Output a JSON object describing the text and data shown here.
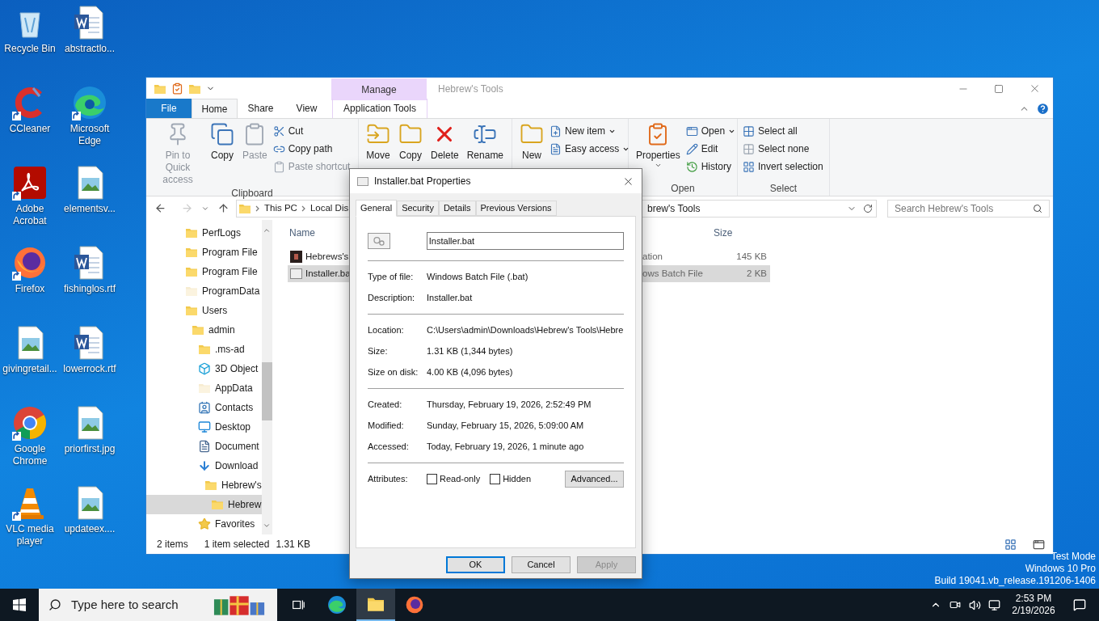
{
  "desktop_icons": [
    {
      "label": "Recycle Bin",
      "kind": "recycle-bin",
      "shortcut": false
    },
    {
      "label": "CCleaner",
      "kind": "ccleaner",
      "shortcut": true
    },
    {
      "label": "Adobe Acrobat",
      "kind": "acrobat",
      "shortcut": true
    },
    {
      "label": "Firefox",
      "kind": "firefox",
      "shortcut": true
    },
    {
      "label": "givingretail...",
      "kind": "image-file",
      "shortcut": false
    },
    {
      "label": "Google Chrome",
      "kind": "chrome",
      "shortcut": true
    },
    {
      "label": "VLC media player",
      "kind": "vlc",
      "shortcut": true
    },
    {
      "label": "abstractlo...",
      "kind": "word-file",
      "shortcut": false
    },
    {
      "label": "Microsoft Edge",
      "kind": "edge",
      "shortcut": true
    },
    {
      "label": "elementsv...",
      "kind": "image-file",
      "shortcut": false
    },
    {
      "label": "fishinglos.rtf",
      "kind": "word-file",
      "shortcut": false
    },
    {
      "label": "lowerrock.rtf",
      "kind": "word-file",
      "shortcut": false
    },
    {
      "label": "priorfirst.jpg",
      "kind": "image-file",
      "shortcut": false
    },
    {
      "label": "updateex....",
      "kind": "image-file",
      "shortcut": false
    }
  ],
  "explorer": {
    "title": "Hebrew's Tools",
    "contextual_group": "Manage",
    "tabs": [
      {
        "label": "File",
        "kind": "file",
        "selected": false
      },
      {
        "label": "Home",
        "kind": "tab",
        "selected": true
      },
      {
        "label": "Share",
        "kind": "tab",
        "selected": false
      },
      {
        "label": "View",
        "kind": "tab",
        "selected": false
      },
      {
        "label": "Application Tools",
        "kind": "contextual",
        "selected": false
      }
    ],
    "ribbon": [
      {
        "label": "Clipboard",
        "items": [
          {
            "label": "Pin to Quick access",
            "kind": "pin",
            "disabled": true,
            "dropdown": false
          },
          {
            "label": "Copy",
            "kind": "copy",
            "disabled": false,
            "dropdown": false
          },
          {
            "label": "Paste",
            "kind": "paste",
            "disabled": true,
            "dropdown": false
          },
          {
            "label": "Cut",
            "kind": "cut",
            "disabled": false,
            "dropdown": false
          },
          {
            "label": "Copy path",
            "kind": "copy-path",
            "disabled": false,
            "dropdown": false
          },
          {
            "label": "Paste shortcut",
            "kind": "paste-shortcut",
            "disabled": true,
            "dropdown": false
          }
        ]
      },
      {
        "items": [
          {
            "label": "Move",
            "kind": "move",
            "disabled": false,
            "dropdown": false
          },
          {
            "label": "Copy",
            "kind": "copy-to",
            "disabled": false,
            "dropdown": false
          },
          {
            "label": "Delete",
            "kind": "delete",
            "disabled": false,
            "dropdown": false
          },
          {
            "label": "Rename",
            "kind": "rename",
            "disabled": false,
            "dropdown": false
          }
        ]
      },
      {
        "items": [
          {
            "label": "New",
            "kind": "new-folder",
            "disabled": false,
            "dropdown": false
          },
          {
            "label": "New item",
            "kind": "new-item",
            "disabled": false,
            "dropdown": true
          },
          {
            "label": "Easy access",
            "kind": "easy-access",
            "disabled": false,
            "dropdown": true
          }
        ]
      },
      {
        "label": "Open",
        "items": [
          {
            "label": "Properties",
            "kind": "properties",
            "disabled": false,
            "dropdown": true
          },
          {
            "label": "Open",
            "kind": "open",
            "disabled": false,
            "dropdown": true
          },
          {
            "label": "Edit",
            "kind": "edit",
            "disabled": false,
            "dropdown": false
          },
          {
            "label": "History",
            "kind": "history",
            "disabled": false,
            "dropdown": false
          }
        ]
      },
      {
        "label": "Select",
        "items": [
          {
            "label": "Select all",
            "kind": "select-all",
            "disabled": false,
            "dropdown": false
          },
          {
            "label": "Select none",
            "kind": "select-none",
            "disabled": false,
            "dropdown": false
          },
          {
            "label": "Invert selection",
            "kind": "invert",
            "disabled": false,
            "dropdown": false
          }
        ]
      }
    ],
    "address": {
      "segments": [
        "This PC",
        "Local Dis"
      ],
      "tail": "brew's Tools"
    },
    "search": {
      "placeholder": "Search Hebrew's Tools"
    },
    "nav_tree": [
      {
        "label": "PerfLogs",
        "kind": "folder",
        "selected": false
      },
      {
        "label": "Program File",
        "kind": "folder",
        "selected": false
      },
      {
        "label": "Program File",
        "kind": "folder",
        "selected": false
      },
      {
        "label": "ProgramData",
        "kind": "folder-faded",
        "selected": false
      },
      {
        "label": "Users",
        "kind": "folder",
        "selected": false,
        "children": [
          {
            "label": "admin",
            "kind": "folder",
            "selected": false,
            "children": [
              {
                "label": ".ms-ad",
                "kind": "folder",
                "selected": false
              },
              {
                "label": "3D Object",
                "kind": "cube",
                "selected": false
              },
              {
                "label": "AppData",
                "kind": "folder-faded",
                "selected": false
              },
              {
                "label": "Contacts",
                "kind": "contacts",
                "selected": false
              },
              {
                "label": "Desktop",
                "kind": "desktop",
                "selected": false
              },
              {
                "label": "Document",
                "kind": "document",
                "selected": false
              },
              {
                "label": "Download",
                "kind": "download",
                "selected": false,
                "children": [
                  {
                    "label": "Hebrew's",
                    "kind": "folder",
                    "selected": false,
                    "children": [
                      {
                        "label": "Hebrew",
                        "kind": "folder",
                        "selected": true
                      }
                    ]
                  }
                ]
              },
              {
                "label": "Favorites",
                "kind": "star",
                "selected": false
              }
            ]
          }
        ]
      }
    ],
    "columns": [
      {
        "label": "Name"
      },
      {
        "label": "Size"
      }
    ],
    "rows": [
      {
        "name": "Hebrews's",
        "type": "ation",
        "size": "145 KB",
        "kind": "app",
        "selected": false
      },
      {
        "name": "Installer.ba",
        "type": "ows Batch File",
        "size": "2 KB",
        "kind": "batch",
        "selected": true
      }
    ],
    "status_bar": {
      "count": "2 items",
      "selection": "1 item selected",
      "size": "1.31 KB"
    }
  },
  "properties_dialog": {
    "title": "Installer.bat Properties",
    "tabs": [
      {
        "label": "General",
        "selected": true
      },
      {
        "label": "Security",
        "selected": false
      },
      {
        "label": "Details",
        "selected": false
      },
      {
        "label": "Previous Versions",
        "selected": false
      }
    ],
    "file_name": "Installer.bat",
    "sections": [
      [
        {
          "label": "Type of file:",
          "value": "Windows Batch File (.bat)"
        },
        {
          "label": "Description:",
          "value": "Installer.bat"
        }
      ],
      [
        {
          "label": "Location:",
          "value": "C:\\Users\\admin\\Downloads\\Hebrew's Tools\\Hebre"
        },
        {
          "label": "Size:",
          "value": "1.31 KB (1,344 bytes)"
        },
        {
          "label": "Size on disk:",
          "value": "4.00 KB (4,096 bytes)"
        }
      ],
      [
        {
          "label": "Created:",
          "value": "Thursday, February 19, 2026, 2:52:49 PM"
        },
        {
          "label": "Modified:",
          "value": "Sunday, February 15, 2026, 5:09:00 AM"
        },
        {
          "label": "Accessed:",
          "value": "Today, February 19, 2026, 1 minute ago"
        }
      ]
    ],
    "attributes": {
      "label": "Attributes:",
      "checkboxes": [
        {
          "label": "Read-only",
          "checked": false
        },
        {
          "label": "Hidden",
          "checked": false
        }
      ],
      "advanced": "Advanced..."
    },
    "buttons": [
      {
        "label": "OK",
        "default": true,
        "disabled": false
      },
      {
        "label": "Cancel",
        "default": false,
        "disabled": false
      },
      {
        "label": "Apply",
        "default": false,
        "disabled": true
      }
    ]
  },
  "desktop_notice": [
    "Test Mode",
    "Windows 10 Pro",
    "Build 19041.vb_release.191206-1406"
  ],
  "taskbar": {
    "search_placeholder": "Type here to search",
    "apps": [
      {
        "kind": "task-view",
        "active": false
      },
      {
        "kind": "edge",
        "active": false
      },
      {
        "kind": "explorer",
        "active": true
      },
      {
        "kind": "firefox",
        "active": false
      }
    ],
    "time": "2:53 PM",
    "date": "2/19/2026"
  }
}
